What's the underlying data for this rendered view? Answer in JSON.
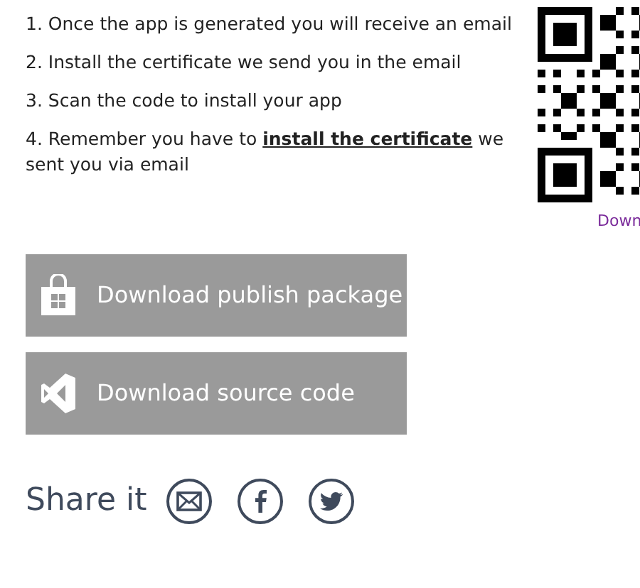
{
  "steps": [
    {
      "text": "1. Once the app is generated you will receive an email"
    },
    {
      "text": "2. Install the certificate we send you in the email"
    },
    {
      "text": "3. Scan the code to install your app"
    },
    {
      "text": "4. Remember you have to",
      "link": "install the certificate",
      "after": "we sent you via email"
    }
  ],
  "qr": {
    "caption": "Down"
  },
  "buttons": [
    {
      "kind": "store",
      "label": "Download publish package"
    },
    {
      "kind": "studio",
      "label": "Download source code"
    }
  ],
  "share": {
    "label": "Share it",
    "icons": [
      {
        "kind": "email"
      },
      {
        "kind": "facebook"
      },
      {
        "kind": "twitter"
      }
    ]
  }
}
